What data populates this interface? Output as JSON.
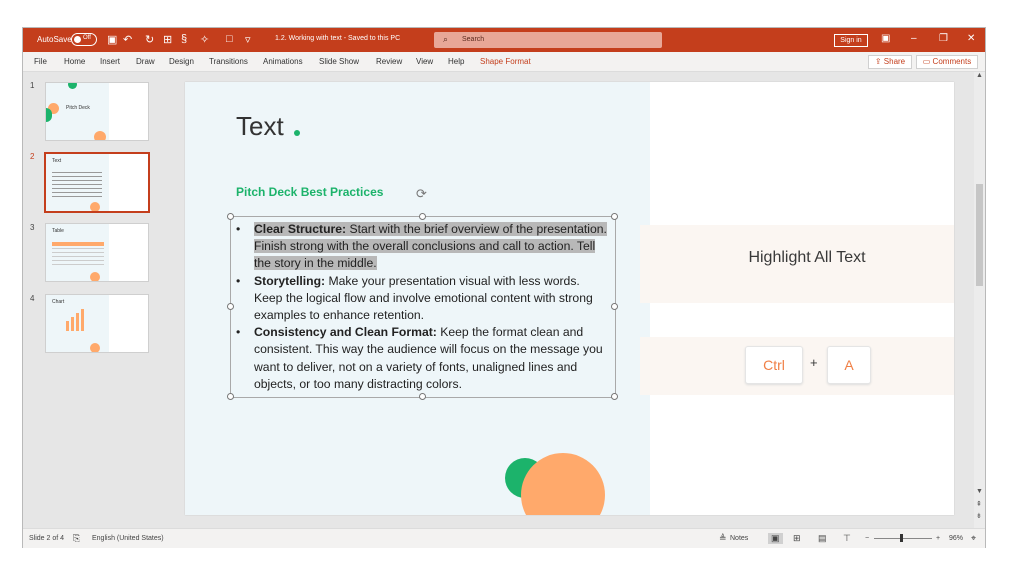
{
  "titlebar": {
    "autosave_label": "AutoSave",
    "autosave_state": "Off",
    "doc_title": "1.2. Working with text  -  Saved to this PC",
    "search_placeholder": "Search",
    "signin_label": "Sign in"
  },
  "menu": {
    "items": [
      "File",
      "Home",
      "Insert",
      "Draw",
      "Design",
      "Transitions",
      "Animations",
      "Slide Show",
      "Review",
      "View",
      "Help",
      "Shape Format"
    ],
    "share": "Share",
    "comments": "Comments",
    "active_color": "#c43e1c"
  },
  "thumbnails": [
    {
      "num": "1",
      "title": "Pitch Deck"
    },
    {
      "num": "2",
      "title": "Text"
    },
    {
      "num": "3",
      "title": "Table"
    },
    {
      "num": "4",
      "title": "Chart"
    }
  ],
  "slide": {
    "title": "Text",
    "subheading": "Pitch Deck Best Practices",
    "bullets": [
      {
        "bold": "Clear Structure:",
        "rest": "Start with the brief overview of the presentation. Finish strong with the overall conclusions and call to action. Tell the story in the middle."
      },
      {
        "bold": "Storytelling:",
        "rest": "Make your presentation visual with less words. Keep the logical flow and involve emotional content with strong examples to enhance retention."
      },
      {
        "bold": "Consistency and Clean Format:",
        "rest": "Keep the format clean and consistent. This way the audience will focus on the message you want to deliver, not on a variety of fonts, unaligned lines and objects, or too many distracting colors."
      }
    ],
    "card_text": "Highlight All Text",
    "shortcut": {
      "key1": "Ctrl",
      "plus": "+",
      "key2": "A"
    }
  },
  "status": {
    "slide_info": "Slide 2 of 4",
    "language": "English (United States)",
    "notes": "Notes",
    "zoom": "96%"
  },
  "colors": {
    "brand": "#c43e1c",
    "green": "#1cb36b",
    "orange": "#ffa96b"
  }
}
